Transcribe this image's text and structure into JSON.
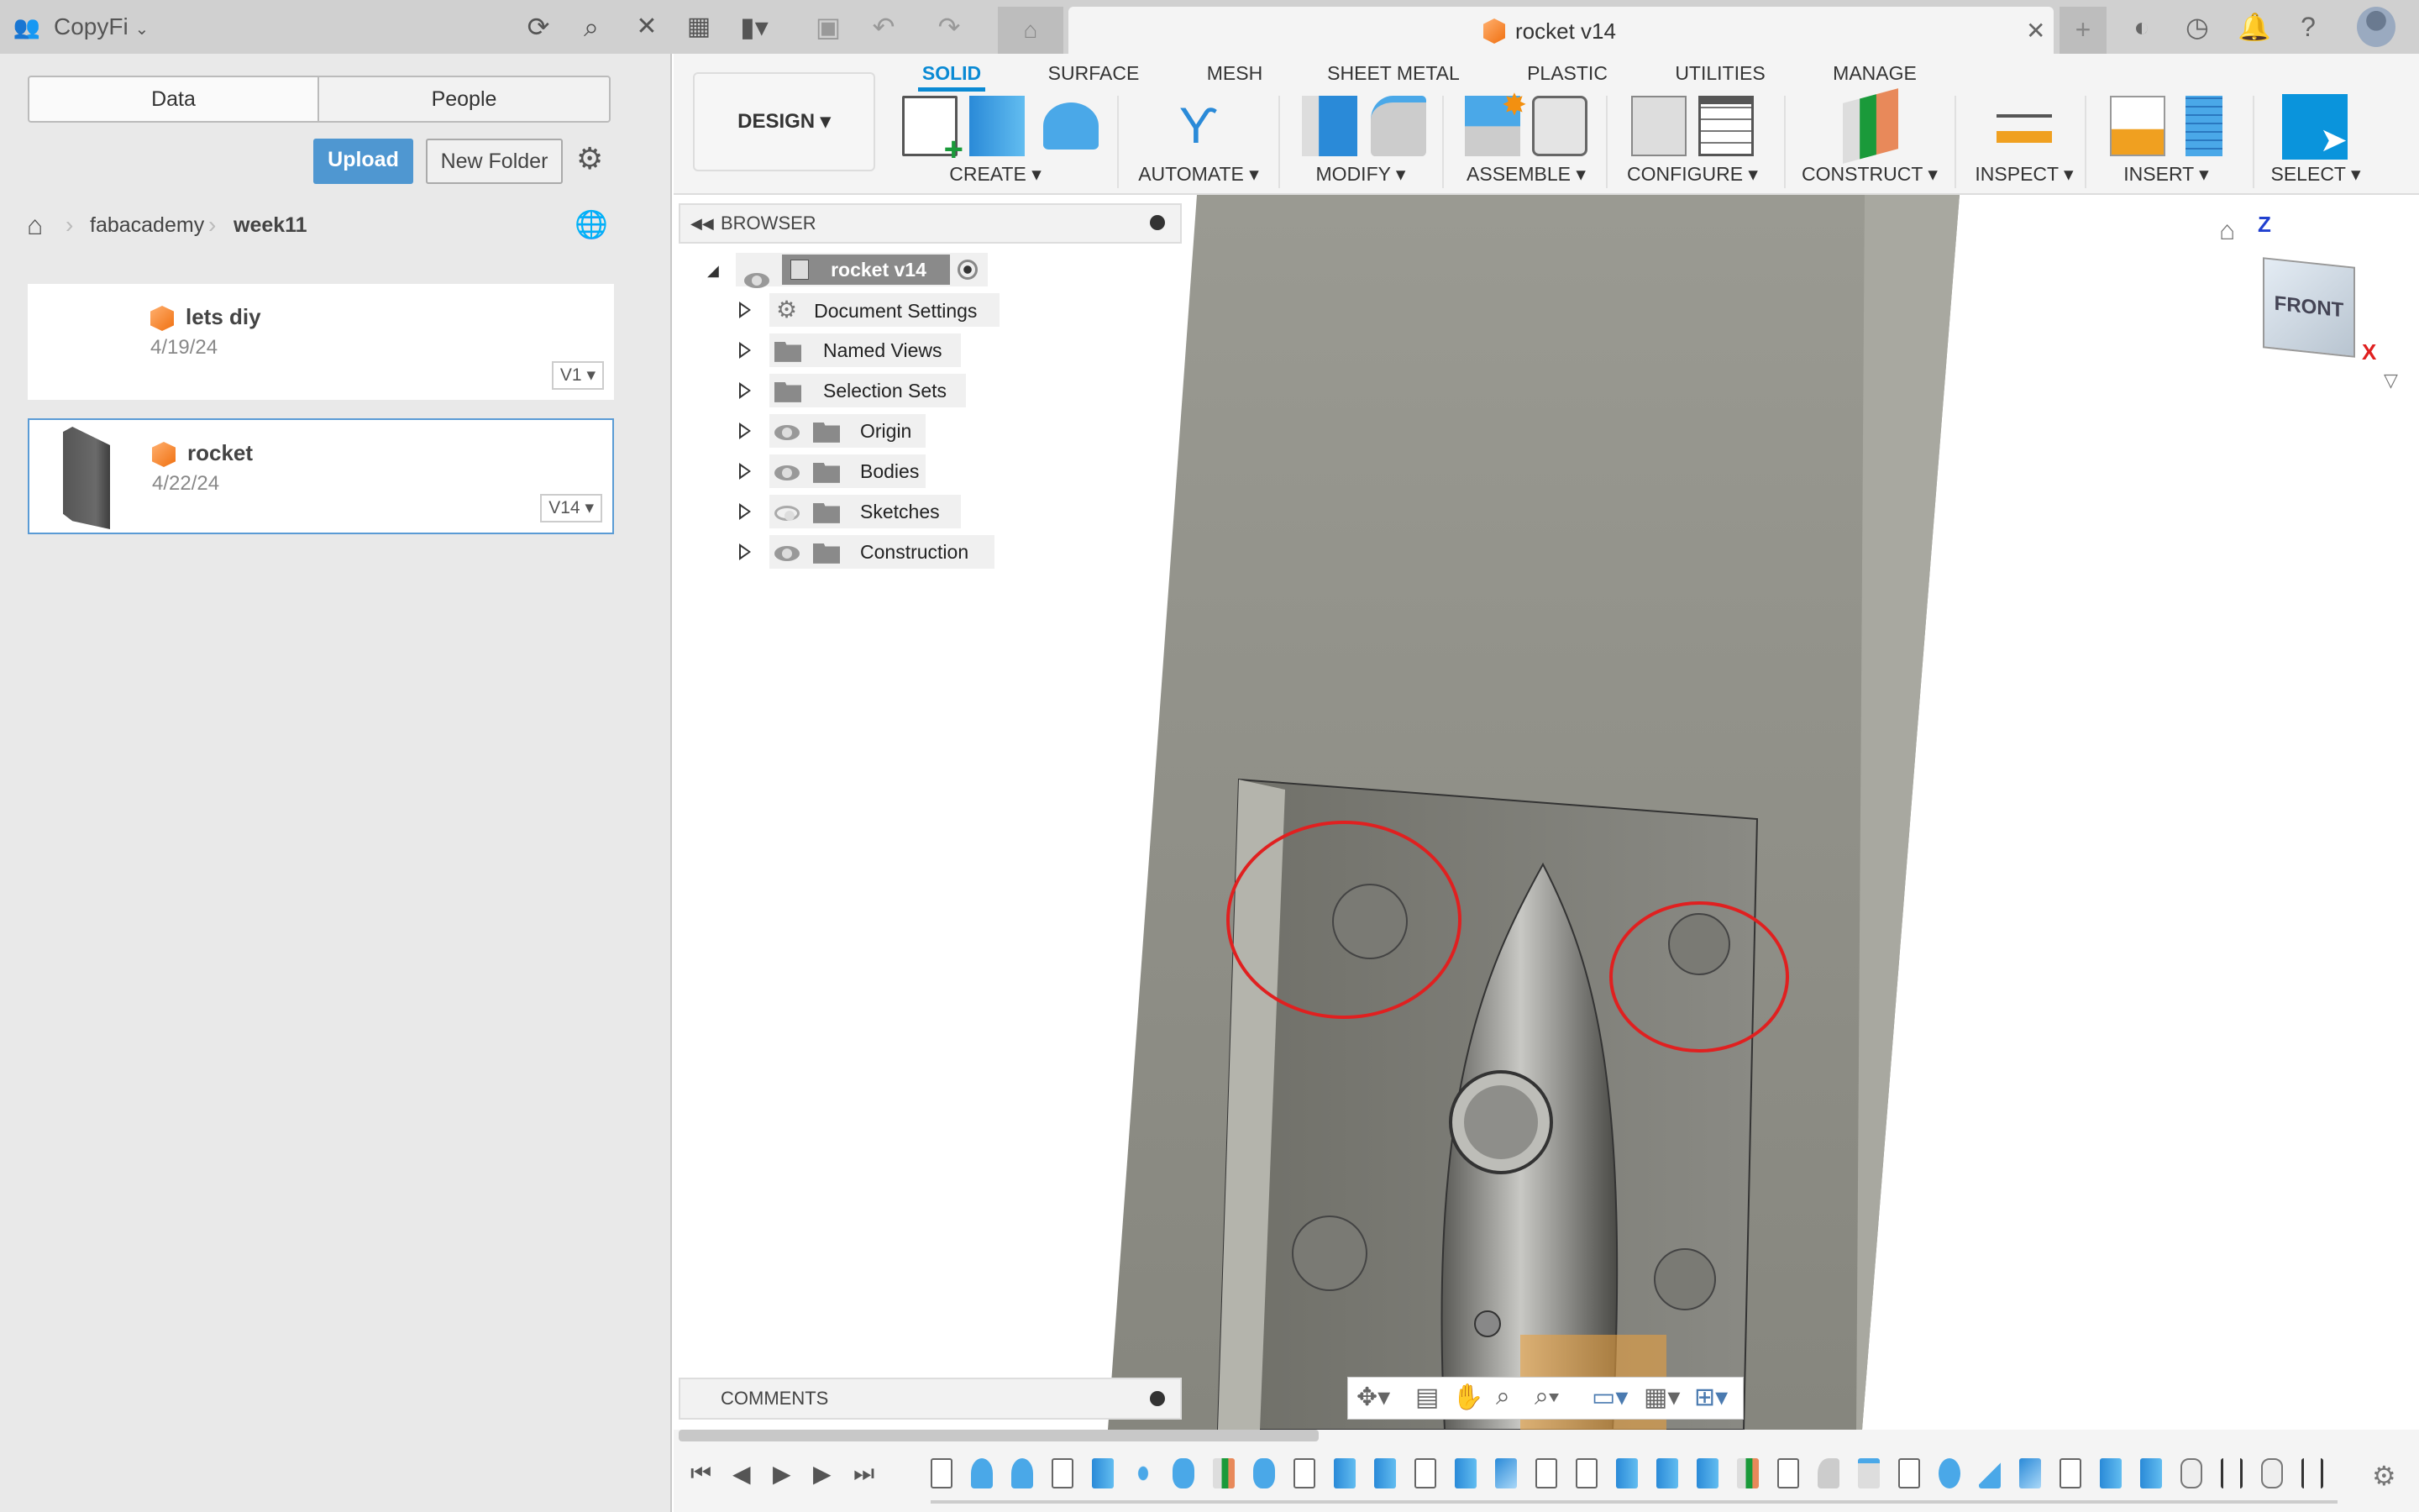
{
  "topbar": {
    "team": "CopyFi",
    "icons": [
      "people-icon",
      "refresh-icon",
      "search-icon",
      "close-icon",
      "apps-grid-icon",
      "file-icon",
      "save-icon",
      "undo-icon",
      "redo-icon",
      "home-icon"
    ],
    "doc_tab": "rocket v14",
    "right_icons": [
      "new-tab-icon",
      "extensions-icon",
      "job-status-icon",
      "notifications-icon",
      "help-icon",
      "avatar"
    ]
  },
  "left_panel": {
    "tabs": [
      "Data",
      "People"
    ],
    "upload": "Upload",
    "new_folder": "New Folder",
    "breadcrumb": [
      "fabacademy",
      "week11"
    ],
    "files": [
      {
        "name": "lets diy",
        "date": "4/19/24",
        "version": "V1"
      },
      {
        "name": "rocket",
        "date": "4/22/24",
        "version": "V14",
        "selected": true
      }
    ]
  },
  "toolbar": {
    "workspace": "DESIGN",
    "tabs": [
      "SOLID",
      "SURFACE",
      "MESH",
      "SHEET METAL",
      "PLASTIC",
      "UTILITIES",
      "MANAGE"
    ],
    "active_tab": "SOLID",
    "groups": [
      "CREATE",
      "AUTOMATE",
      "MODIFY",
      "ASSEMBLE",
      "CONFIGURE",
      "CONSTRUCT",
      "INSPECT",
      "INSERT",
      "SELECT"
    ]
  },
  "browser": {
    "title": "BROWSER",
    "root": "rocket v14",
    "items": [
      {
        "label": "Document Settings",
        "icon": "gear-icon"
      },
      {
        "label": "Named Views",
        "icon": "folder-icon"
      },
      {
        "label": "Selection Sets",
        "icon": "folder-icon"
      },
      {
        "label": "Origin",
        "icon": "folder-icon",
        "visible": true
      },
      {
        "label": "Bodies",
        "icon": "folder-icon",
        "visible": true
      },
      {
        "label": "Sketches",
        "icon": "folder-icon",
        "visible": false
      },
      {
        "label": "Construction",
        "icon": "folder-icon",
        "visible": true
      }
    ]
  },
  "viewcube": {
    "face": "FRONT",
    "axis_z": "Z",
    "axis_x": "X"
  },
  "comments": {
    "title": "COMMENTS"
  },
  "colors": {
    "accent": "#0a8ad4",
    "annotation": "#e02020",
    "model": "#8c8c84"
  },
  "timeline": {
    "features": [
      "sketch",
      "revolve",
      "revolve",
      "sketch",
      "extrude",
      "pattern",
      "body",
      "split",
      "body",
      "sketch",
      "extrude",
      "extrude",
      "sketch",
      "extrude",
      "combine",
      "sketch",
      "sketch",
      "extrude",
      "extrude",
      "extrude",
      "split",
      "sketch",
      "fillet",
      "chamfer",
      "sketch",
      "sphere",
      "plane",
      "combine",
      "sketch",
      "extrude",
      "extrude",
      "joint",
      "move",
      "joint",
      "move"
    ]
  }
}
